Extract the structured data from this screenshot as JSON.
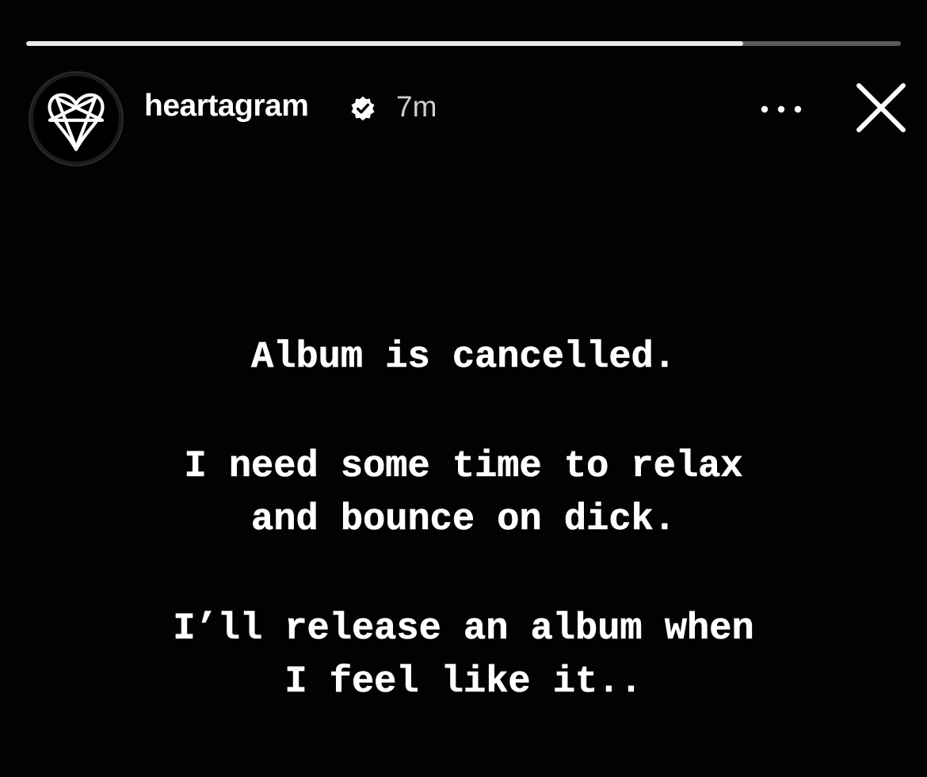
{
  "story": {
    "progress": 0.82,
    "username": "heartagram",
    "verified_icon": "verified-badge-icon",
    "time": "7m",
    "more_icon": "more-horizontal-icon",
    "close_icon": "close-icon",
    "avatar_icon": "heartagram-logo-icon"
  },
  "message": {
    "line1": "Album is cancelled.",
    "line2": "I need some time to relax",
    "line3": "and bounce on dick.",
    "line4": "I’ll release an album when",
    "line5": "I feel like it.."
  },
  "colors": {
    "background": "#020202",
    "text": "#ffffff",
    "time": "#cfcfcf",
    "progress_fill": "#e9e9e9"
  }
}
